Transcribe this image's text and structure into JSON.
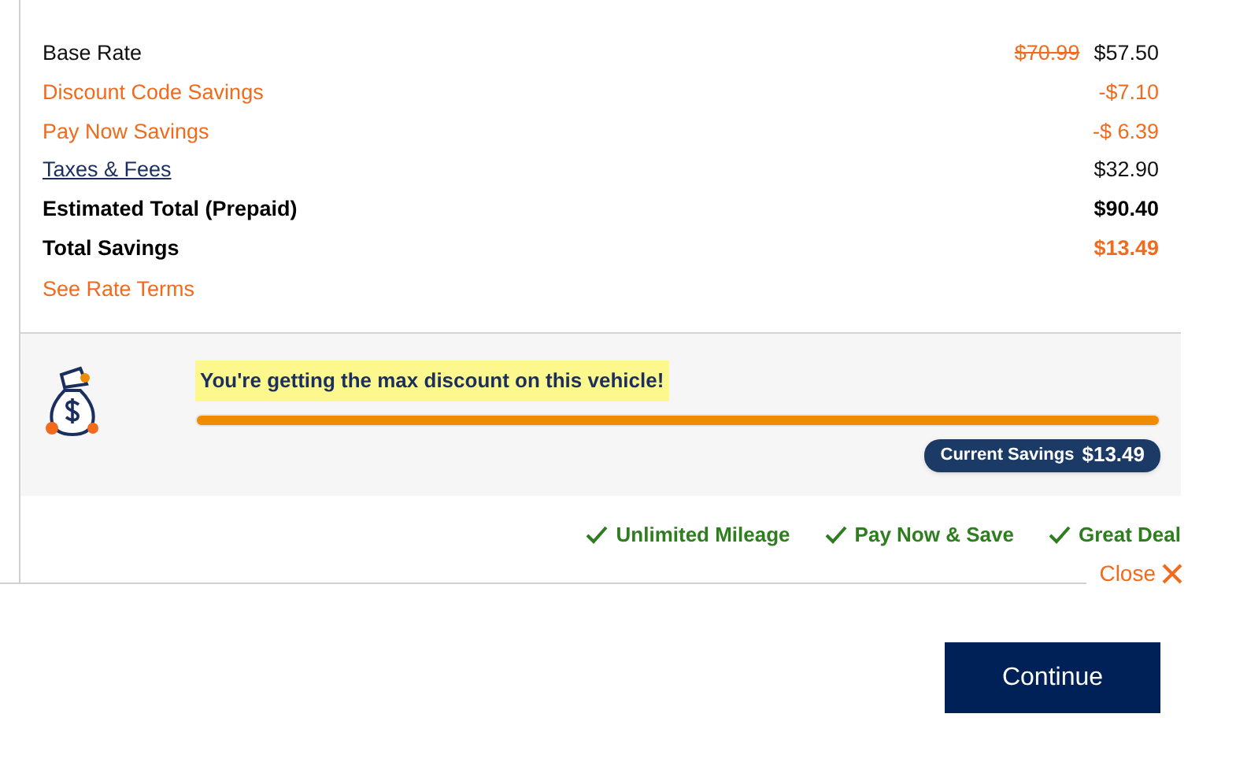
{
  "price_rows": [
    {
      "kind": "strike",
      "label": "Base Rate",
      "old_value": "$70.99",
      "value": "$57.50"
    },
    {
      "kind": "saving",
      "label": "Discount Code Savings",
      "value": "-$7.10"
    },
    {
      "kind": "saving",
      "label": "Pay Now Savings",
      "value": "-$ 6.39"
    },
    {
      "kind": "link",
      "label": "Taxes & Fees",
      "value": "$32.90"
    },
    {
      "kind": "total",
      "label": "Estimated Total (Prepaid)",
      "value": "$90.40"
    },
    {
      "kind": "total_saving",
      "label": "Total Savings",
      "value": "$13.49"
    }
  ],
  "rate_terms_link": "See Rate Terms",
  "discount_panel": {
    "message": "You're getting the max discount on this vehicle!",
    "level": 1,
    "savings_label": "Current Savings",
    "savings_value": "$13.49"
  },
  "features": [
    "Unlimited Mileage",
    "Pay Now & Save",
    "Great Deal"
  ],
  "close": {
    "label": "Close"
  },
  "continue_button": "Continue"
}
